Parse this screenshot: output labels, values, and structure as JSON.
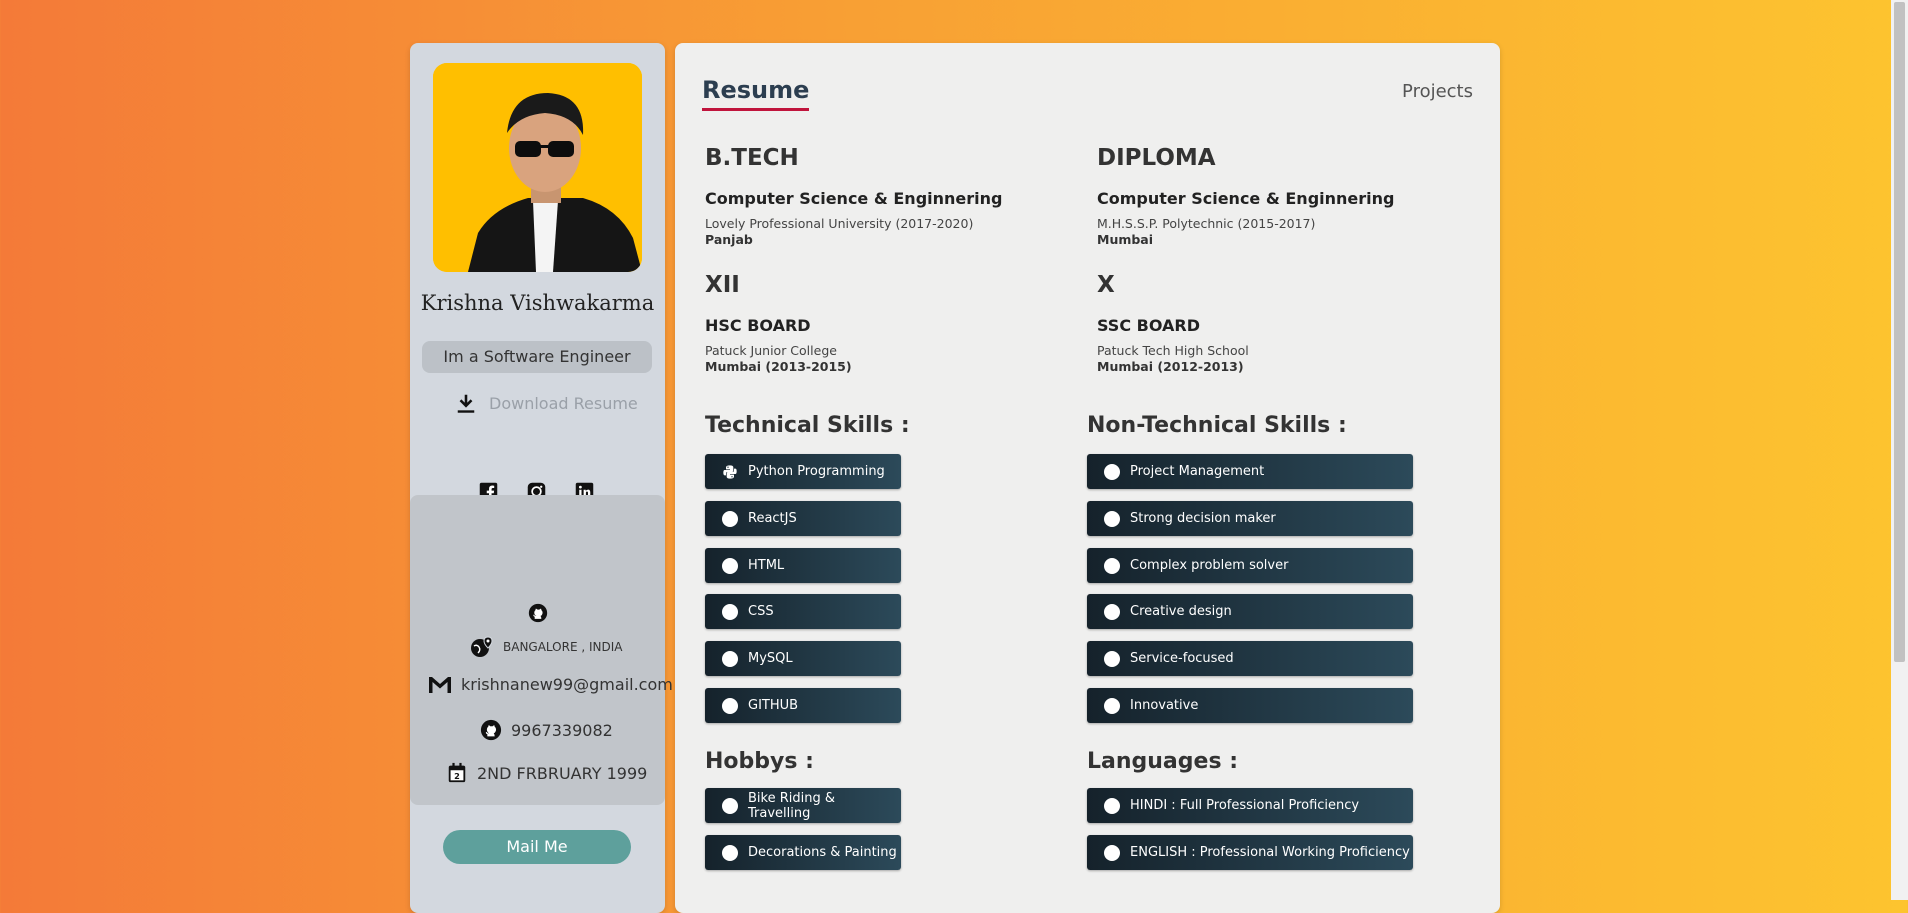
{
  "profile": {
    "name": "Krishna Vishwakarma",
    "role": "Im a Software Engineer",
    "download_label": "Download Resume",
    "avatar_bg": "#ffbf00"
  },
  "social": [
    "facebook-icon",
    "instagram-icon",
    "linkedin-icon"
  ],
  "contact": {
    "location": "BANGALORE , INDIA",
    "email": "krishnanew99@gmail.com",
    "phone": "9967339082",
    "dob": "2ND FRBRUARY 1999",
    "mail_button": "Mail Me"
  },
  "nav": {
    "resume": "Resume",
    "projects": "Projects"
  },
  "education": [
    {
      "degree": "B.TECH",
      "field": "Computer Science & Enginnering",
      "institute": "Lovely Professional University (2017-2020)",
      "location": "Panjab"
    },
    {
      "degree": "DIPLOMA",
      "field": "Computer Science & Enginnering",
      "institute": "M.H.S.S.P. Polytechnic (2015-2017)",
      "location": "Mumbai"
    },
    {
      "degree": "XII",
      "field": "HSC BOARD",
      "institute": "Patuck Junior College",
      "location": "Mumbai (2013-2015)"
    },
    {
      "degree": "X",
      "field": "SSC BOARD",
      "institute": "Patuck Tech High School",
      "location": "Mumbai (2012-2013)"
    }
  ],
  "technical": {
    "title": "Technical Skills :",
    "items": [
      "Python Programming",
      "ReactJS",
      "HTML",
      "CSS",
      "MySQL",
      "GITHUB"
    ]
  },
  "nontechnical": {
    "title": "Non-Technical Skills :",
    "items": [
      "Project Management",
      "Strong decision maker",
      "Complex problem solver",
      "Creative design",
      "Service-focused",
      "Innovative"
    ]
  },
  "hobbies": {
    "title": "Hobbys :",
    "items": [
      "Bike Riding & Travelling",
      "Decorations & Painting"
    ]
  },
  "languages": {
    "title": "Languages :",
    "items": [
      "HINDI : Full Professional Proficiency",
      "ENGLISH : Professional Working Proficiency"
    ]
  },
  "colors": {
    "accent": "#c0143c",
    "chip_start": "#15222b",
    "chip_end": "#2c4a5a",
    "mail_button": "#5ea09c"
  }
}
